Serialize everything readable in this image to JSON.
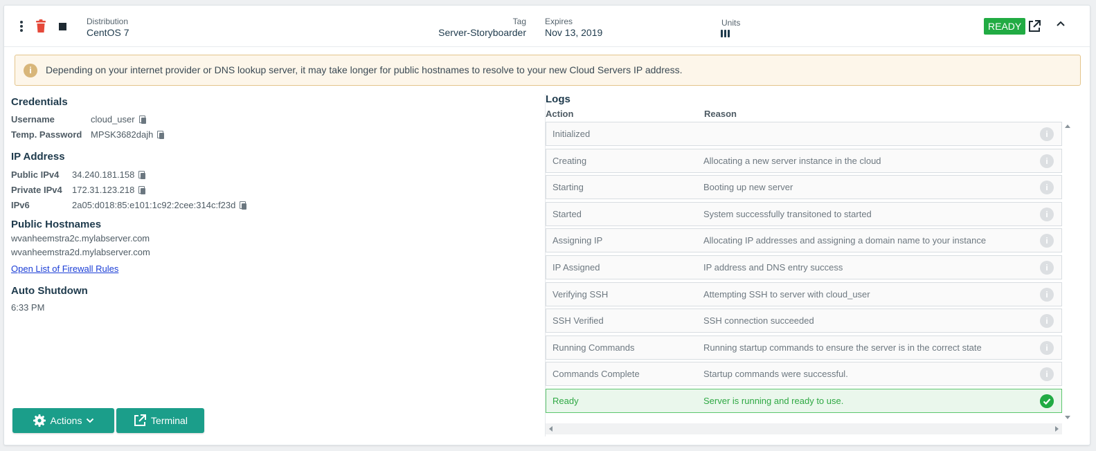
{
  "header": {
    "distribution_label": "Distribution",
    "distribution_value": "CentOS 7",
    "tag_label": "Tag",
    "tag_value": "Server-Storyboarder",
    "expires_label": "Expires",
    "expires_value": "Nov 13, 2019",
    "units_label": "Units",
    "status": "READY",
    "status_color": "#21ab43",
    "delete_color": "#e5493a"
  },
  "notice": {
    "text": "Depending on your internet provider or DNS lookup server, it may take longer for public hostnames to resolve to your new Cloud Servers IP address.",
    "icon": "i"
  },
  "credentials": {
    "title": "Credentials",
    "username_label": "Username",
    "username": "cloud_user",
    "password_label": "Temp. Password",
    "password": "MPSK3682dajh"
  },
  "ip": {
    "title": "IP Address",
    "public_v4_label": "Public IPv4",
    "public_v4": "34.240.181.158",
    "private_v4_label": "Private IPv4",
    "private_v4": "172.31.123.218",
    "v6_label": "IPv6",
    "v6": "2a05:d018:85:e101:1c92:2cee:314c:f23d"
  },
  "hostnames": {
    "title": "Public Hostnames",
    "items": [
      "wvanheemstra2c.mylabserver.com",
      "wvanheemstra2d.mylabserver.com"
    ],
    "firewall_link": "Open List of Firewall Rules"
  },
  "shutdown": {
    "title": "Auto Shutdown",
    "time": "6:33 PM"
  },
  "buttons": {
    "actions": "Actions",
    "terminal": "Terminal",
    "color": "#1b9e8a"
  },
  "logs": {
    "title": "Logs",
    "col_action": "Action",
    "col_reason": "Reason",
    "info_icon": "i",
    "rows": [
      {
        "action": "Initialized",
        "reason": ""
      },
      {
        "action": "Creating",
        "reason": "Allocating a new server instance in the cloud"
      },
      {
        "action": "Starting",
        "reason": "Booting up new server"
      },
      {
        "action": "Started",
        "reason": "System successfully transitoned to started"
      },
      {
        "action": "Assigning IP",
        "reason": "Allocating IP addresses and assigning a domain name to your instance"
      },
      {
        "action": "IP Assigned",
        "reason": "IP address and DNS entry success"
      },
      {
        "action": "Verifying SSH",
        "reason": "Attempting SSH to server with cloud_user"
      },
      {
        "action": "SSH Verified",
        "reason": "SSH connection succeeded"
      },
      {
        "action": "Running Commands",
        "reason": "Running startup commands to ensure the server is in the correct state"
      },
      {
        "action": "Commands Complete",
        "reason": "Startup commands were successful."
      },
      {
        "action": "Ready",
        "reason": "Server is running and ready to use."
      }
    ]
  }
}
